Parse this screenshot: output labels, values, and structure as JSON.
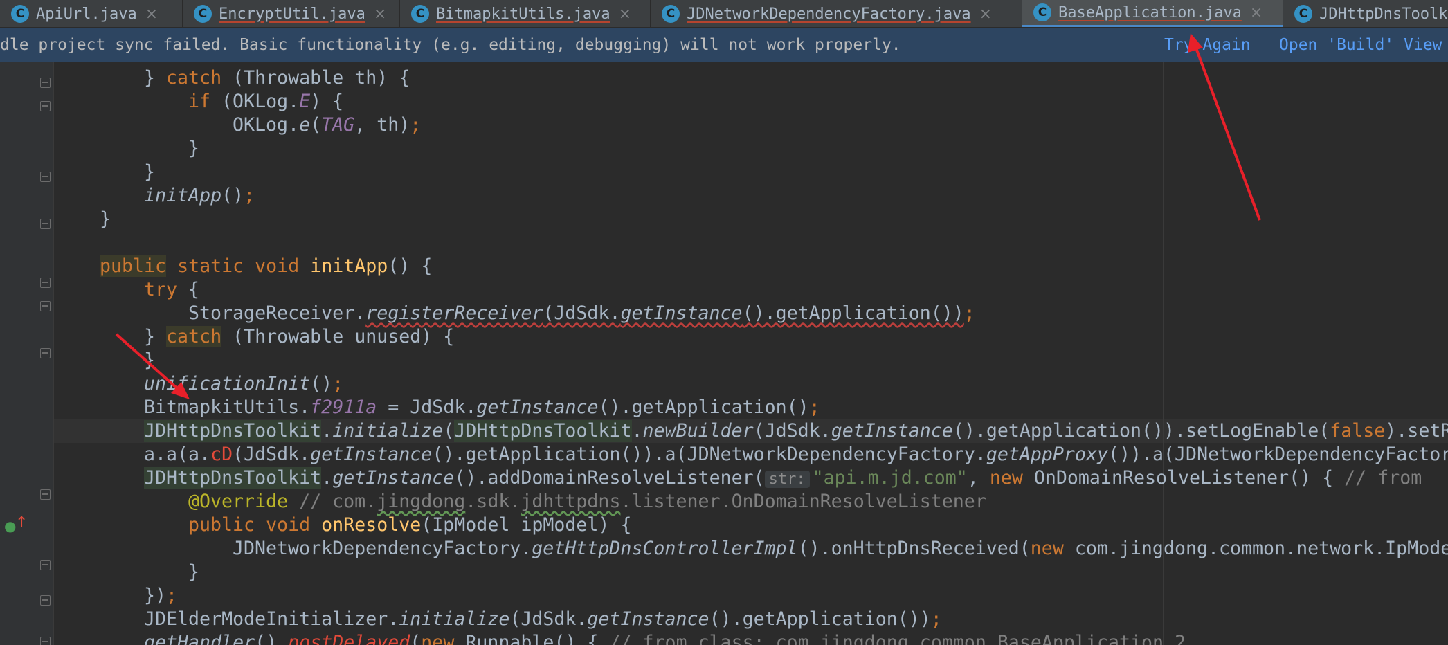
{
  "tabs": [
    {
      "icon": "C",
      "label": "ApiUrl.java",
      "close": "×",
      "active": false
    },
    {
      "icon": "C",
      "label": "EncryptUtil.java",
      "close": "×",
      "active": false
    },
    {
      "icon": "C",
      "label": "BitmapkitUtils.java",
      "close": "×",
      "active": false
    },
    {
      "icon": "C",
      "label": "JDNetworkDependencyFactory.java",
      "close": "×",
      "active": false
    },
    {
      "icon": "C",
      "label": "BaseApplication.java",
      "close": "×",
      "active": true
    },
    {
      "icon": "C",
      "label": "JDHttpDnsToolk",
      "close": "",
      "active": false
    }
  ],
  "banner": {
    "message": "dle project sync failed. Basic functionality (e.g. editing, debugging) will not work properly.",
    "try_again": "Try Again",
    "open_build": "Open 'Build' View"
  },
  "code": {
    "l1_a": "} ",
    "l1_kw": "catch",
    "l1_b": " (Throwable th) {",
    "l2_kw": "if",
    "l2_a": " (OKLog.",
    "l2_st": "E",
    "l2_b": ") {",
    "l3_a": "OKLog.",
    "l3_fn": "e",
    "l3_b": "(",
    "l3_st": "TAG",
    "l3_c": ", th)",
    "l3_d": ";",
    "l4": "}",
    "l5": "}",
    "l6_fn": "initApp",
    "l6_a": "()",
    "l6_b": ";",
    "l7": "}",
    "l8_kw1": "public",
    "l8_kw2": " static void ",
    "l8_fn": "initApp",
    "l8_a": "() {",
    "l9_kw": "try",
    "l9_a": " {",
    "l10_a": "StorageReceiver.",
    "l10_fn": "registerReceiver",
    "l10_b": "(JdSdk.",
    "l10_fn2": "getInstance",
    "l10_c": "().getApplication())",
    "l10_d": ";",
    "l11_a": "} ",
    "l11_kw": "catch",
    "l11_b": " (Throwable unused) {",
    "l12": "}",
    "l13_fn": "unificationInit",
    "l13_a": "()",
    "l13_b": ";",
    "l14_a": "BitmapkitUtils.",
    "l14_st": "f2911a",
    "l14_b": " = JdSdk.",
    "l14_fn": "getInstance",
    "l14_c": "().getApplication()",
    "l14_d": ";",
    "l15_a": "JDHttpDnsToolkit",
    "l15_b": ".",
    "l15_fn": "initialize",
    "l15_c": "(",
    "l15_d": "JDHttpDnsToolkit",
    "l15_e": ".",
    "l15_fn2": "newBuilder",
    "l15_f": "(JdSdk.",
    "l15_fn3": "getInstance",
    "l15_g": "().getApplication()).setLogEnable(",
    "l15_kw": "false",
    "l15_h": ").setR",
    "l16_a": "a.a(a.",
    "l16_cd": "cD",
    "l16_b": "(JdSdk.",
    "l16_fn": "getInstance",
    "l16_c": "().getApplication()).a(JDNetworkDependencyFactory.",
    "l16_fn2": "getAppProxy",
    "l16_d": "()).a(JDNetworkDependencyFactor",
    "l17_a": "JDHttpDnsToolkit",
    "l17_b": ".",
    "l17_fn": "getInstance",
    "l17_c": "().addDomainResolveListener(",
    "l17_hint": "str:",
    "l17_str": "\"api.m.jd.com\"",
    "l17_d": ", ",
    "l17_kw": "new",
    "l17_e": " OnDomainResolveListener() { ",
    "l17_cm": "// from",
    "l18_ann": "@Override",
    "l18_cm1": " // com.",
    "l18_cm2": "jingdong",
    "l18_cm3": ".sdk.",
    "l18_cm4": "jdhttpdns",
    "l18_cm5": ".listener.OnDomainResolveListener",
    "l19_kw": "public void ",
    "l19_fn": "onResolve",
    "l19_a": "(IpModel ipModel) {",
    "l20_a": "JDNetworkDependencyFactory.",
    "l20_fn": "getHttpDnsControllerImpl",
    "l20_b": "().onHttpDnsReceived(",
    "l20_kw": "new",
    "l20_c": " com.jingdong.common.network.IpMode",
    "l21": "}",
    "l22_a": "})",
    "l22_b": ";",
    "l23_a": "JDElderModeInitializer.",
    "l23_fn": "initialize",
    "l23_b": "(JdSdk.",
    "l23_fn2": "getInstance",
    "l23_c": "().getApplication())",
    "l23_d": ";",
    "l24_fn": "getHandler",
    "l24_a": "().",
    "l24_fn2": "postDelayed",
    "l24_b": "(",
    "l24_kw": "new",
    "l24_c": " Runnable() { ",
    "l24_cm": "// from class: com.jingdong.common.BaseApplication.2"
  },
  "colors": {
    "accent": "#4a88c7",
    "link": "#589df6",
    "annotation_arrow": "#e8202a",
    "error_underline": "#bc3f3c"
  }
}
